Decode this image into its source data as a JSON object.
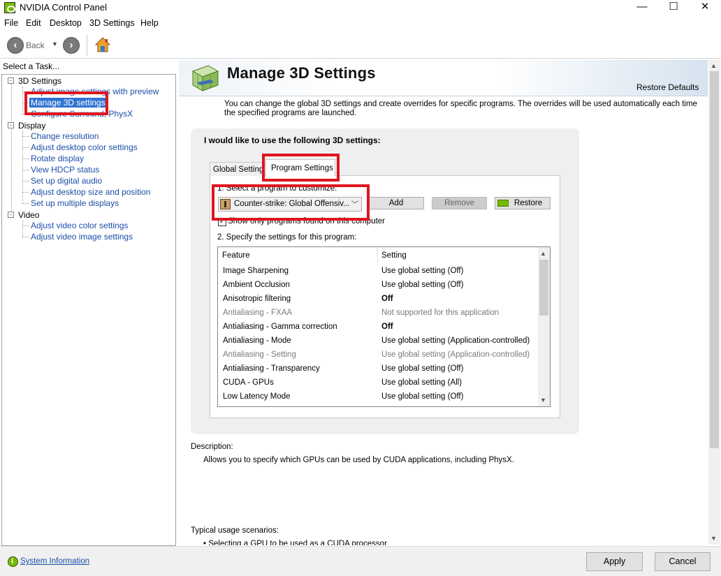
{
  "window": {
    "title": "NVIDIA Control Panel",
    "minimize": "—",
    "maximize": "☐",
    "close": "✕"
  },
  "menu": [
    "File",
    "Edit",
    "Desktop",
    "3D Settings",
    "Help"
  ],
  "toolbar": {
    "back_label": "Back",
    "back_icon": "arrow-left-icon",
    "forward_icon": "arrow-right-icon",
    "home_icon": "home-icon"
  },
  "left_pane": {
    "label": "Select a Task...",
    "categories": [
      {
        "name": "3D Settings",
        "items": [
          "Adjust image settings with preview",
          "Manage 3D settings",
          "Configure Surround, PhysX"
        ]
      },
      {
        "name": "Display",
        "items": [
          "Change resolution",
          "Adjust desktop color settings",
          "Rotate display",
          "View HDCP status",
          "Set up digital audio",
          "Adjust desktop size and position",
          "Set up multiple displays"
        ]
      },
      {
        "name": "Video",
        "items": [
          "Adjust video color settings",
          "Adjust video image settings"
        ]
      }
    ],
    "selected_item": "Manage 3D settings"
  },
  "header": {
    "title": "Manage 3D Settings",
    "restore_defaults": "Restore Defaults"
  },
  "intro": "You can change the global 3D settings and create overrides for specific programs. The overrides will be used automatically each time the specified programs are launched.",
  "settings": {
    "heading": "I would like to use the following 3D settings:",
    "tabs": [
      "Global Settings",
      "Program Settings"
    ],
    "active_tab": "Program Settings",
    "step1": "1. Select a program to customize:",
    "program": "Counter-strike: Global Offensiv...",
    "add": "Add",
    "remove": "Remove",
    "restore": "Restore",
    "show_only": "Show only programs found on this computer",
    "show_only_checked": "✓",
    "step2": "2. Specify the settings for this program:",
    "col_feature": "Feature",
    "col_setting": "Setting",
    "rows": [
      {
        "feature": "Image Sharpening",
        "setting": "Use global setting (Off)"
      },
      {
        "feature": "Ambient Occlusion",
        "setting": "Use global setting (Off)"
      },
      {
        "feature": "Anisotropic filtering",
        "setting": "Off"
      },
      {
        "feature": "Antialiasing - FXAA",
        "setting": "Not supported for this application"
      },
      {
        "feature": "Antialiasing - Gamma correction",
        "setting": "Off"
      },
      {
        "feature": "Antialiasing - Mode",
        "setting": "Use global setting (Application-controlled)"
      },
      {
        "feature": "Antialiasing - Setting",
        "setting": "Use global setting (Application-controlled)"
      },
      {
        "feature": "Antialiasing - Transparency",
        "setting": "Use global setting (Off)"
      },
      {
        "feature": "CUDA - GPUs",
        "setting": "Use global setting (All)"
      },
      {
        "feature": "Low Latency Mode",
        "setting": "Use global setting (Off)"
      }
    ]
  },
  "description": {
    "label": "Description:",
    "text": "Allows you to specify which GPUs can be used by CUDA applications, including PhysX."
  },
  "usage": {
    "label": "Typical usage scenarios:",
    "item": "• Selecting a GPU to be used as a CUDA processor"
  },
  "footer": {
    "system_info": "System Information",
    "apply": "Apply",
    "cancel": "Cancel"
  },
  "colors": {
    "nvidia_green": "#76b900",
    "selection_blue": "#3073d0",
    "link_blue": "#1a4ea8",
    "highlight_red": "#e0141e"
  }
}
